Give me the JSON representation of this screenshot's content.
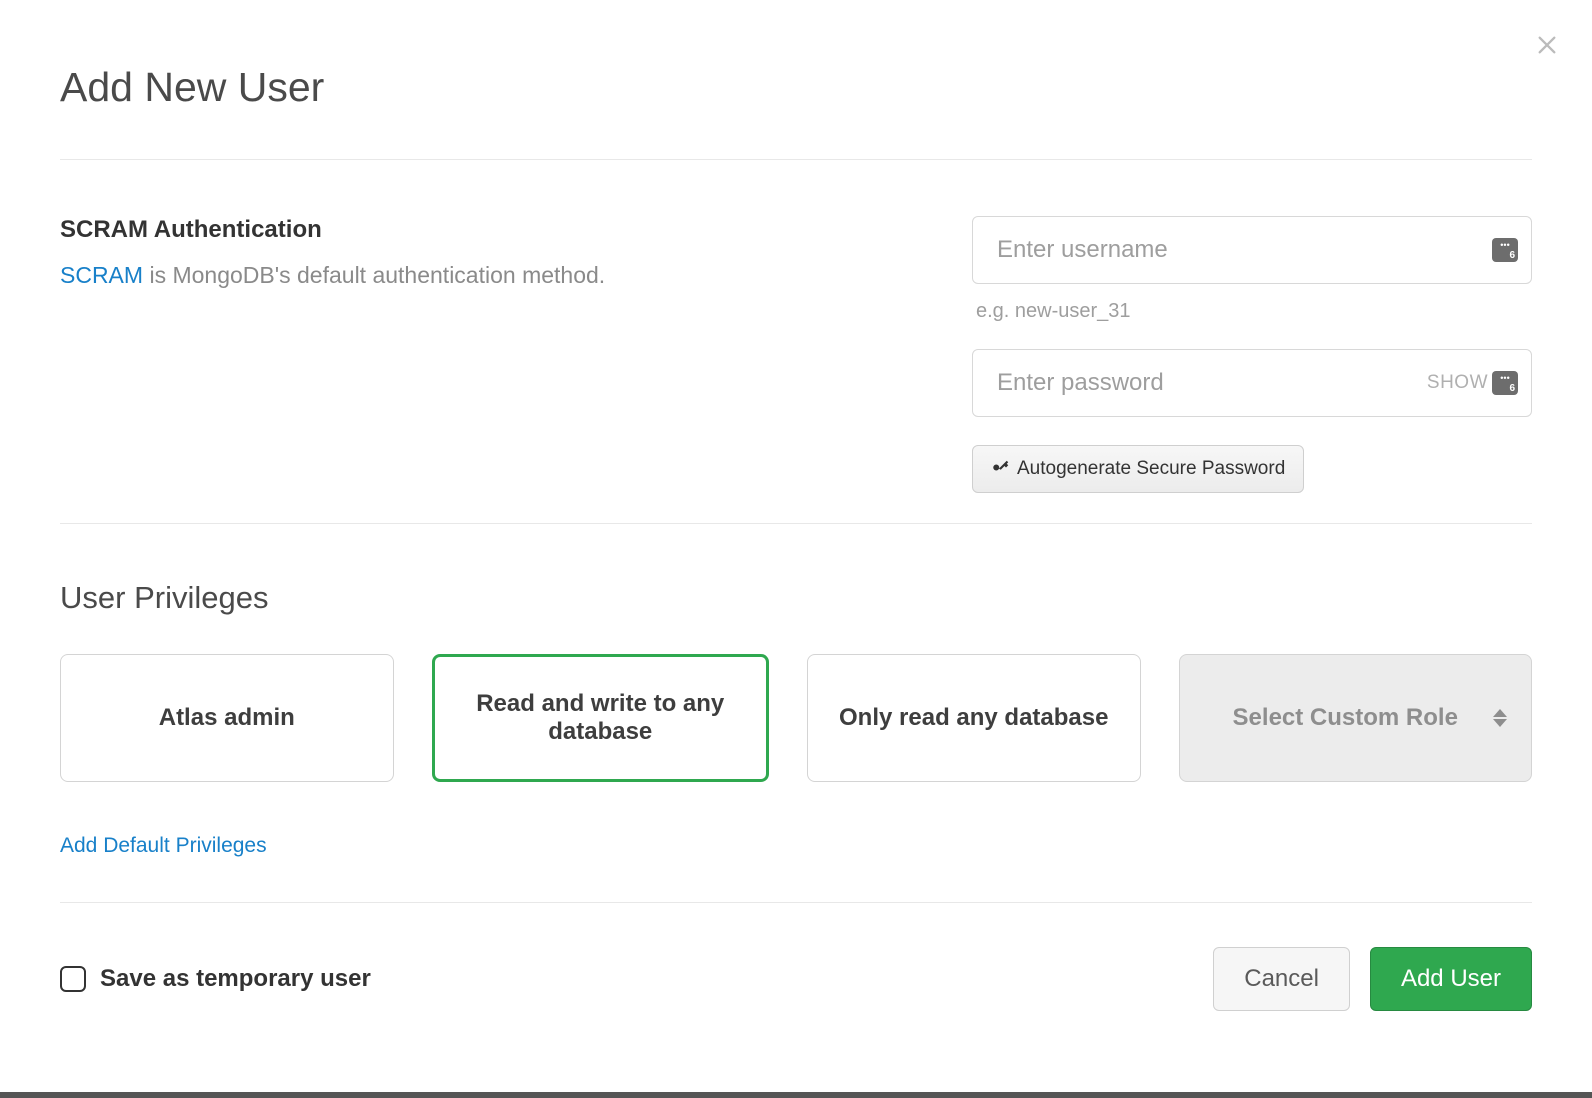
{
  "title": "Add New User",
  "auth": {
    "heading": "SCRAM Authentication",
    "link_text": "SCRAM",
    "desc_rest": " is MongoDB's default authentication method.",
    "username_placeholder": "Enter username",
    "username_hint": "e.g. new-user_31",
    "password_placeholder": "Enter password",
    "show_label": "SHOW",
    "autogen_label": "Autogenerate Secure Password",
    "badge_count": "6"
  },
  "privileges": {
    "heading": "User Privileges",
    "options": [
      {
        "label": "Atlas admin",
        "selected": false
      },
      {
        "label": "Read and write to any database",
        "selected": true
      },
      {
        "label": "Only read any database",
        "selected": false
      }
    ],
    "custom_label": "Select Custom Role",
    "add_default_link": "Add Default Privileges"
  },
  "footer": {
    "temp_user_label": "Save as temporary user",
    "cancel": "Cancel",
    "submit": "Add User"
  }
}
